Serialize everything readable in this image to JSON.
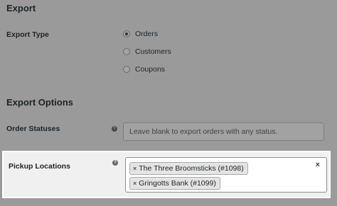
{
  "export": {
    "title": "Export",
    "type_label": "Export Type",
    "options": [
      {
        "label": "Orders",
        "checked": true
      },
      {
        "label": "Customers",
        "checked": false
      },
      {
        "label": "Coupons",
        "checked": false
      }
    ]
  },
  "export_options": {
    "title": "Export Options",
    "order_statuses": {
      "label": "Order Statuses",
      "help_icon": "?",
      "placeholder": "Leave blank to export orders with any status."
    },
    "pickup_locations": {
      "label": "Pickup Locations",
      "help_icon": "?",
      "tags": [
        {
          "remove": "×",
          "label": "The Three Broomsticks (#1098)"
        },
        {
          "remove": "×",
          "label": "Gringotts Bank (#1099)"
        }
      ],
      "clear_icon": "×"
    }
  },
  "icons": {
    "help": "help-icon",
    "remove_tag": "close-icon",
    "clear": "clear-icon"
  },
  "colors": {
    "overlay_bg": "#9a9a9a",
    "highlight_bg": "#f0f0f1",
    "tag_bg": "#e4e4e4"
  }
}
